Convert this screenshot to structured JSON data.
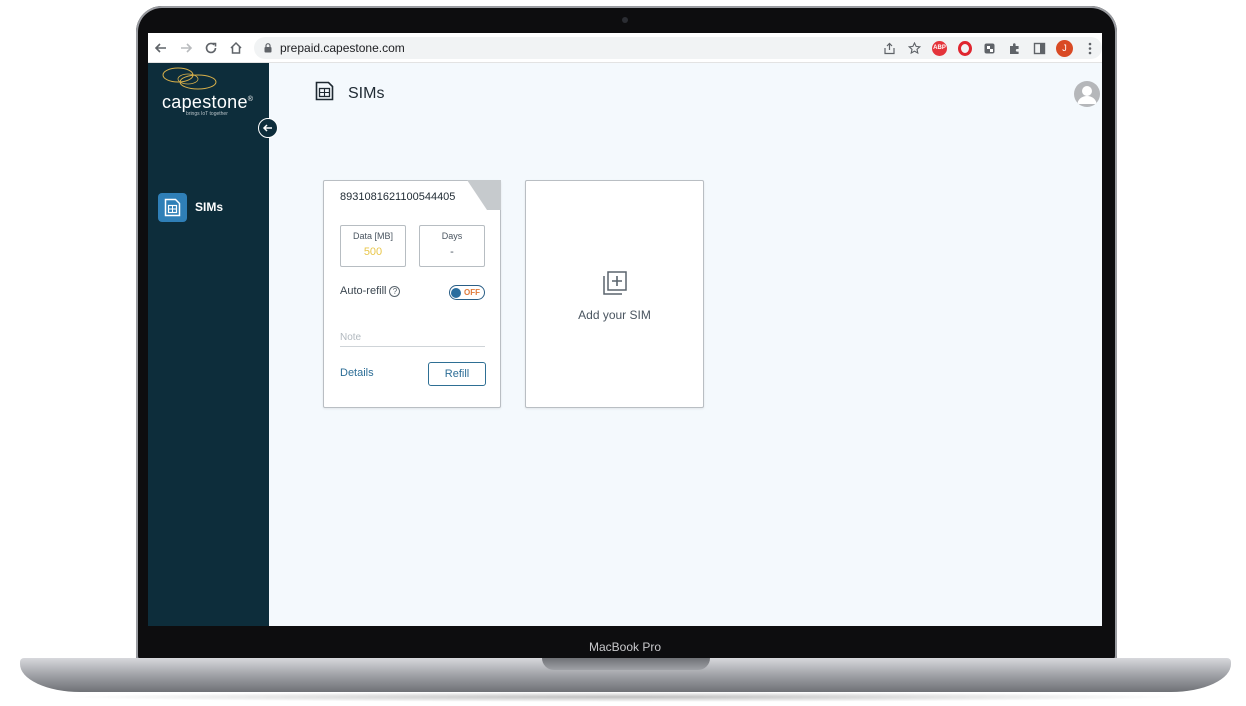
{
  "laptop": {
    "model_label": "MacBook Pro"
  },
  "browser": {
    "url": "prepaid.capestone.com",
    "extensions": {
      "abp_label": "ABP"
    },
    "profile_initial": "J"
  },
  "sidebar": {
    "logo_text": "capestone",
    "logo_mark": "®",
    "tagline": "brings IoT together",
    "items": [
      {
        "label": "SIMs",
        "icon": "sim-card-icon"
      }
    ]
  },
  "page": {
    "title": "SIMs"
  },
  "sim_card": {
    "iccid": "8931081621100544405",
    "data_label": "Data [MB]",
    "data_value": "500",
    "days_label": "Days",
    "days_value": "-",
    "autorefill_label": "Auto-refill",
    "help_glyph": "?",
    "toggle_state": "OFF",
    "note_placeholder": "Note",
    "details_label": "Details",
    "refill_label": "Refill"
  },
  "add_card": {
    "label": "Add your SIM"
  },
  "colors": {
    "sidebar_bg": "#0d2d3b",
    "accent": "#2c6d96",
    "data_value": "#e8c64a",
    "toggle_off": "#e07a3a"
  }
}
